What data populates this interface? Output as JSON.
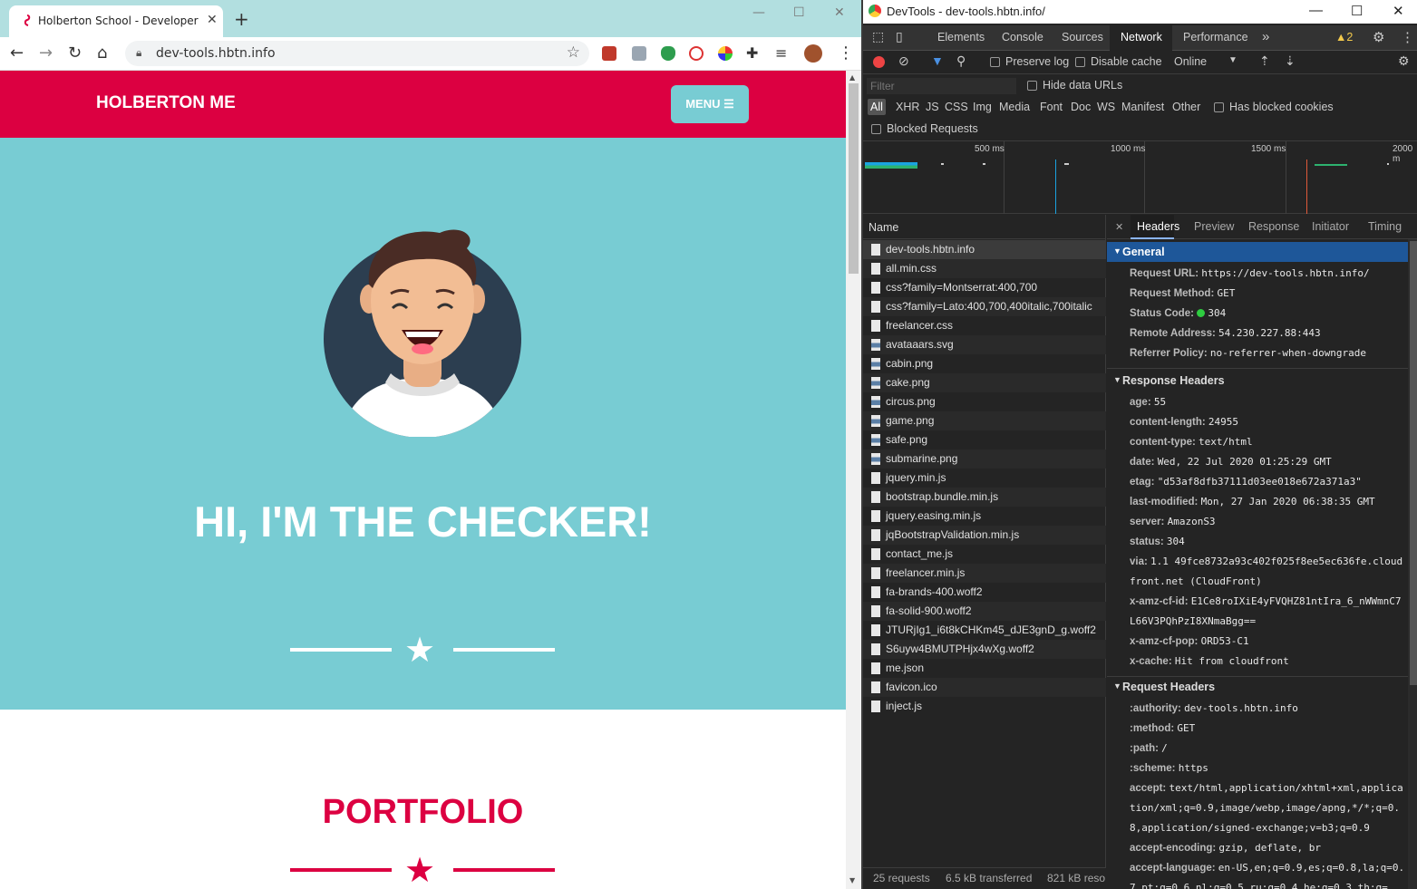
{
  "browser": {
    "tab_title": "Holberton School - Developer to",
    "tab_close": "✕",
    "new_tab": "+",
    "address": "dev-tools.hbtn.info"
  },
  "site": {
    "brand": "HOLBERTON ME",
    "menu_label": "MENU ☰",
    "headline": "HI, I'M THE CHECKER!",
    "portfolio_title": "PORTFOLIO",
    "colors": {
      "primary": "#dc0041",
      "teal": "#78ccd3",
      "navy": "#2c3e50"
    }
  },
  "devtools": {
    "title": "DevTools - dev-tools.hbtn.info/",
    "tabs": [
      "Elements",
      "Console",
      "Sources",
      "Network",
      "Performance"
    ],
    "active_tab": "Network",
    "more_tabs": "»",
    "warnings": "▲2",
    "preserve_log": "Preserve log",
    "disable_cache": "Disable cache",
    "throttle": "Online",
    "filter_placeholder": "Filter",
    "hide_data_urls": "Hide data URLs",
    "type_filters": [
      "All",
      "XHR",
      "JS",
      "CSS",
      "Img",
      "Media",
      "Font",
      "Doc",
      "WS",
      "Manifest",
      "Other"
    ],
    "has_blocked_cookies": "Has blocked cookies",
    "blocked_requests": "Blocked Requests",
    "timeline_labels": [
      "500 ms",
      "1000 ms",
      "1500 ms",
      "2000 m"
    ],
    "name_header": "Name",
    "requests": [
      "dev-tools.hbtn.info",
      "all.min.css",
      "css?family=Montserrat:400,700",
      "css?family=Lato:400,700,400italic,700italic",
      "freelancer.css",
      "avataaars.svg",
      "cabin.png",
      "cake.png",
      "circus.png",
      "game.png",
      "safe.png",
      "submarine.png",
      "jquery.min.js",
      "bootstrap.bundle.min.js",
      "jquery.easing.min.js",
      "jqBootstrapValidation.min.js",
      "contact_me.js",
      "freelancer.min.js",
      "fa-brands-400.woff2",
      "fa-solid-900.woff2",
      "JTURjIg1_i6t8kCHKm45_dJE3gnD_g.woff2",
      "S6uyw4BMUTPHjx4wXg.woff2",
      "me.json",
      "favicon.ico",
      "inject.js"
    ],
    "status_bar": {
      "requests": "25 requests",
      "transferred": "6.5 kB transferred",
      "resources": "821 kB reso"
    },
    "detail_tabs": [
      "Headers",
      "Preview",
      "Response",
      "Initiator",
      "Timing"
    ],
    "detail_close": "✕",
    "general": {
      "title": "General",
      "rows": [
        {
          "k": "Request URL:",
          "v": "https://dev-tools.hbtn.info/"
        },
        {
          "k": "Request Method:",
          "v": "GET"
        },
        {
          "k": "Status Code:",
          "v": "304"
        },
        {
          "k": "Remote Address:",
          "v": "54.230.227.88:443"
        },
        {
          "k": "Referrer Policy:",
          "v": "no-referrer-when-downgrade"
        }
      ]
    },
    "response_headers": {
      "title": "Response Headers",
      "rows": [
        {
          "k": "age:",
          "v": "55"
        },
        {
          "k": "content-length:",
          "v": "24955"
        },
        {
          "k": "content-type:",
          "v": "text/html"
        },
        {
          "k": "date:",
          "v": "Wed, 22 Jul 2020 01:25:29 GMT"
        },
        {
          "k": "etag:",
          "v": "\"d53af8dfb37111d03ee018e672a371a3\""
        },
        {
          "k": "last-modified:",
          "v": "Mon, 27 Jan 2020 06:38:35 GMT"
        },
        {
          "k": "server:",
          "v": "AmazonS3"
        },
        {
          "k": "status:",
          "v": "304"
        },
        {
          "k": "via:",
          "v": "1.1 49fce8732a93c402f025f8ee5ec636fe.cloudfront.net (CloudFront)"
        },
        {
          "k": "x-amz-cf-id:",
          "v": "E1Ce8roIXiE4yFVQHZ81ntIra_6_nWWmnC7L66V3PQhPzI8XNmaBgg=="
        },
        {
          "k": "x-amz-cf-pop:",
          "v": "ORD53-C1"
        },
        {
          "k": "x-cache:",
          "v": "Hit from cloudfront"
        }
      ]
    },
    "request_headers": {
      "title": "Request Headers",
      "rows": [
        {
          "k": ":authority:",
          "v": "dev-tools.hbtn.info"
        },
        {
          "k": ":method:",
          "v": "GET"
        },
        {
          "k": ":path:",
          "v": "/"
        },
        {
          "k": ":scheme:",
          "v": "https"
        },
        {
          "k": "accept:",
          "v": "text/html,application/xhtml+xml,application/xml;q=0.9,image/webp,image/apng,*/*;q=0.8,application/signed-exchange;v=b3;q=0.9"
        },
        {
          "k": "accept-encoding:",
          "v": "gzip, deflate, br"
        },
        {
          "k": "accept-language:",
          "v": "en-US,en;q=0.9,es;q=0.8,la;q=0.7,pt;q=0.6,nl;q=0.5,ru;q=0.4,he;q=0.3,th;q="
        }
      ]
    }
  }
}
